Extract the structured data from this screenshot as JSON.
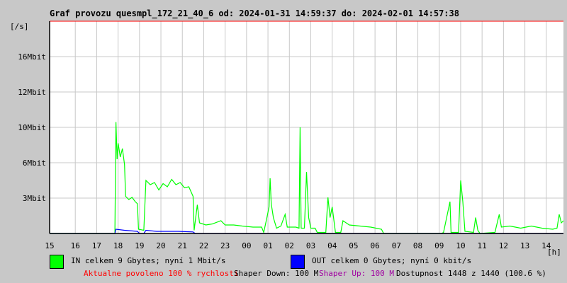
{
  "chart_data": {
    "type": "line",
    "title": "Graf provozu quesmpl_172_21_40_6 od: 2024-01-31 14:59:37 do: 2024-02-01 14:57:38",
    "ylabel": "[/s]",
    "xlabel": "[h]",
    "x_ticks": [
      "15",
      "16",
      "17",
      "18",
      "19",
      "20",
      "21",
      "22",
      "23",
      "00",
      "01",
      "02",
      "03",
      "04",
      "05",
      "06",
      "07",
      "08",
      "09",
      "10",
      "11",
      "12",
      "13",
      "14"
    ],
    "y_ticks": [
      {
        "label": "3Mbit",
        "v": 3.33
      },
      {
        "label": "6Mbit",
        "v": 6.67
      },
      {
        "label": "10Mbit",
        "v": 10
      },
      {
        "label": "12Mbit",
        "v": 13.33
      },
      {
        "label": "16Mbit",
        "v": 16.67
      }
    ],
    "ylim": [
      0,
      20
    ],
    "xlim_hours": [
      0,
      24
    ],
    "grid": true,
    "series": [
      {
        "name": "IN",
        "color": "#00ff00",
        "points": [
          [
            0,
            0
          ],
          [
            3.05,
            0
          ],
          [
            3.1,
            10.5
          ],
          [
            3.15,
            7
          ],
          [
            3.2,
            8.5
          ],
          [
            3.3,
            7.2
          ],
          [
            3.4,
            8
          ],
          [
            3.5,
            6.5
          ],
          [
            3.55,
            3.5
          ],
          [
            3.7,
            3.2
          ],
          [
            3.85,
            3.4
          ],
          [
            4,
            3
          ],
          [
            4.1,
            2.8
          ],
          [
            4.15,
            0.4
          ],
          [
            4.4,
            0.3
          ],
          [
            4.5,
            5
          ],
          [
            4.7,
            4.6
          ],
          [
            4.9,
            4.8
          ],
          [
            5.1,
            4.1
          ],
          [
            5.3,
            4.7
          ],
          [
            5.5,
            4.4
          ],
          [
            5.7,
            5.1
          ],
          [
            5.9,
            4.6
          ],
          [
            6.1,
            4.8
          ],
          [
            6.3,
            4.3
          ],
          [
            6.5,
            4.4
          ],
          [
            6.7,
            3.5
          ],
          [
            6.75,
            0.3
          ],
          [
            6.9,
            2.7
          ],
          [
            7,
            1
          ],
          [
            7.3,
            0.8
          ],
          [
            7.6,
            0.9
          ],
          [
            8,
            1.2
          ],
          [
            8.2,
            0.8
          ],
          [
            8.6,
            0.8
          ],
          [
            9,
            0.7
          ],
          [
            9.5,
            0.6
          ],
          [
            9.9,
            0.6
          ],
          [
            10,
            0.1
          ],
          [
            10.15,
            1.5
          ],
          [
            10.25,
            2.5
          ],
          [
            10.3,
            5.2
          ],
          [
            10.35,
            2.8
          ],
          [
            10.45,
            1.5
          ],
          [
            10.6,
            0.5
          ],
          [
            10.8,
            0.7
          ],
          [
            11,
            1.8
          ],
          [
            11.1,
            0.6
          ],
          [
            11.5,
            0.6
          ],
          [
            11.65,
            0.5
          ],
          [
            11.7,
            10
          ],
          [
            11.75,
            0.5
          ],
          [
            11.9,
            0.5
          ],
          [
            12,
            5.8
          ],
          [
            12.1,
            1.5
          ],
          [
            12.2,
            0.5
          ],
          [
            12.4,
            0.5
          ],
          [
            12.5,
            0.1
          ],
          [
            12.9,
            0.1
          ],
          [
            13,
            3.4
          ],
          [
            13.1,
            1.5
          ],
          [
            13.2,
            2.5
          ],
          [
            13.35,
            0.1
          ],
          [
            13.6,
            0.1
          ],
          [
            13.7,
            1.2
          ],
          [
            14,
            0.8
          ],
          [
            14.5,
            0.7
          ],
          [
            15,
            0.6
          ],
          [
            15.5,
            0.4
          ],
          [
            15.6,
            0
          ],
          [
            18.3,
            0
          ],
          [
            18.4,
            0.1
          ],
          [
            18.7,
            3
          ],
          [
            18.75,
            0.1
          ],
          [
            19.1,
            0.1
          ],
          [
            19.2,
            5
          ],
          [
            19.3,
            3
          ],
          [
            19.4,
            0.2
          ],
          [
            19.8,
            0.1
          ],
          [
            19.9,
            1.5
          ],
          [
            20,
            0.3
          ],
          [
            20.1,
            0
          ],
          [
            20.8,
            0.1
          ],
          [
            21,
            1.8
          ],
          [
            21.1,
            0.6
          ],
          [
            21.5,
            0.7
          ],
          [
            22,
            0.5
          ],
          [
            22.5,
            0.7
          ],
          [
            23,
            0.5
          ],
          [
            23.5,
            0.4
          ],
          [
            23.7,
            0.5
          ],
          [
            23.8,
            1.8
          ],
          [
            23.9,
            1
          ],
          [
            24,
            1.2
          ]
        ]
      },
      {
        "name": "OUT",
        "color": "#0000ff",
        "points": [
          [
            0,
            0
          ],
          [
            3.05,
            0
          ],
          [
            3.1,
            0.4
          ],
          [
            3.5,
            0.3
          ],
          [
            4.1,
            0.2
          ],
          [
            4.2,
            0
          ],
          [
            4.4,
            0
          ],
          [
            4.5,
            0.3
          ],
          [
            5,
            0.2
          ],
          [
            6,
            0.2
          ],
          [
            6.7,
            0.15
          ],
          [
            6.8,
            0
          ],
          [
            24,
            0
          ]
        ]
      }
    ],
    "legend": {
      "in_label": "IN celkem 9 Gbytes; nyní 1 Mbit/s",
      "out_label": "OUT celkem 0 Gbytes; nyní 0 kbit/s"
    },
    "footer": {
      "allowed": "Aktualne povoleno 100 % rychlosti",
      "shaper_down": "Shaper Down: 100 M",
      "shaper_up": "Shaper Up: 100 M",
      "availability": "Dostupnost 1448 z 1440 (100.6 %)"
    },
    "colors": {
      "in": "#00ff00",
      "out": "#0000ff",
      "top": "#ff0000",
      "allowed": "#ff0000",
      "shaper_up": "#a000a0"
    }
  }
}
